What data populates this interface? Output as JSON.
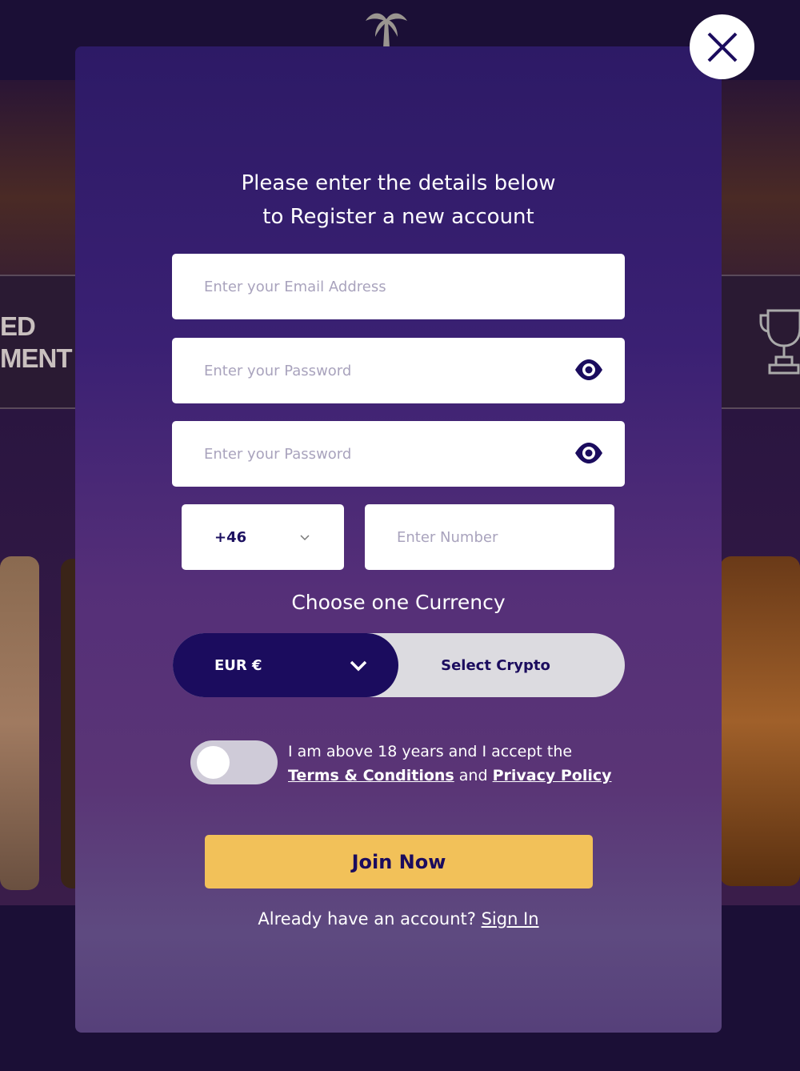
{
  "background": {
    "side_text_line1": "ED",
    "side_text_line2": "MENT"
  },
  "modal": {
    "title_line1": "Please enter the details below",
    "title_line2": "to Register a new account",
    "email_placeholder": "Enter your Email Address",
    "password_placeholder": "Enter your Password",
    "confirm_password_placeholder": "Enter your Password",
    "country_code": "+46",
    "phone_placeholder": "Enter Number",
    "currency_heading": "Choose one Currency",
    "currency_selected": "EUR €",
    "crypto_label": "Select Crypto",
    "age_text": "I am above 18 years and I accept the",
    "terms_link": "Terms & Conditions",
    "and_text": "and",
    "privacy_link": "Privacy Policy",
    "age_toggle_on": false,
    "join_button": "Join Now",
    "signin_prompt": "Already have an account?",
    "signin_link": "Sign In"
  },
  "colors": {
    "accent": "#1b0c5e",
    "join": "#f2c159",
    "modal_top": "#2d1a66"
  }
}
